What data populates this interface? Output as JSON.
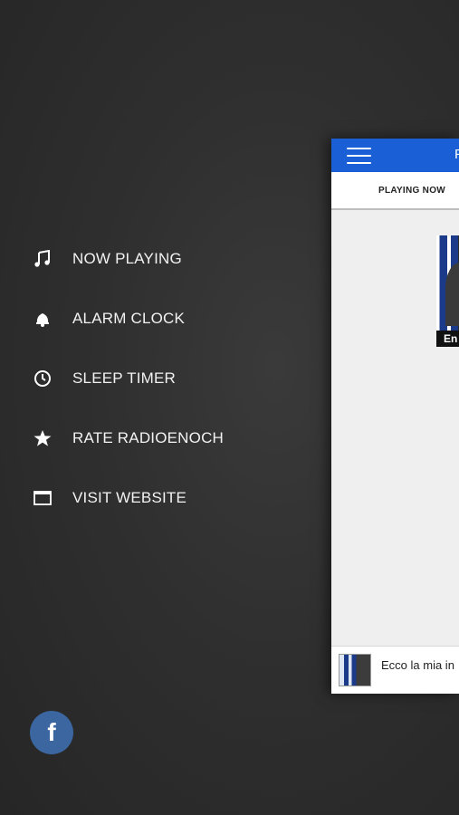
{
  "menu": {
    "items": [
      {
        "label": "NOW PLAYING",
        "icon": "music-note-icon"
      },
      {
        "label": "ALARM CLOCK",
        "icon": "bell-icon"
      },
      {
        "label": "SLEEP TIMER",
        "icon": "clock-icon"
      },
      {
        "label": "RATE RADIOENOCH",
        "icon": "star-icon"
      },
      {
        "label": "VISIT WEBSITE",
        "icon": "browser-window-icon"
      }
    ]
  },
  "social": {
    "facebook_label": "f",
    "icon": "facebook-icon",
    "color": "#3b66a0"
  },
  "app": {
    "header_color": "#1a5fd6",
    "header_title": "F",
    "tab_playing": "PLAYING NOW",
    "artwork_caption": "En",
    "mini_player_title": "Ecco la mia in"
  }
}
